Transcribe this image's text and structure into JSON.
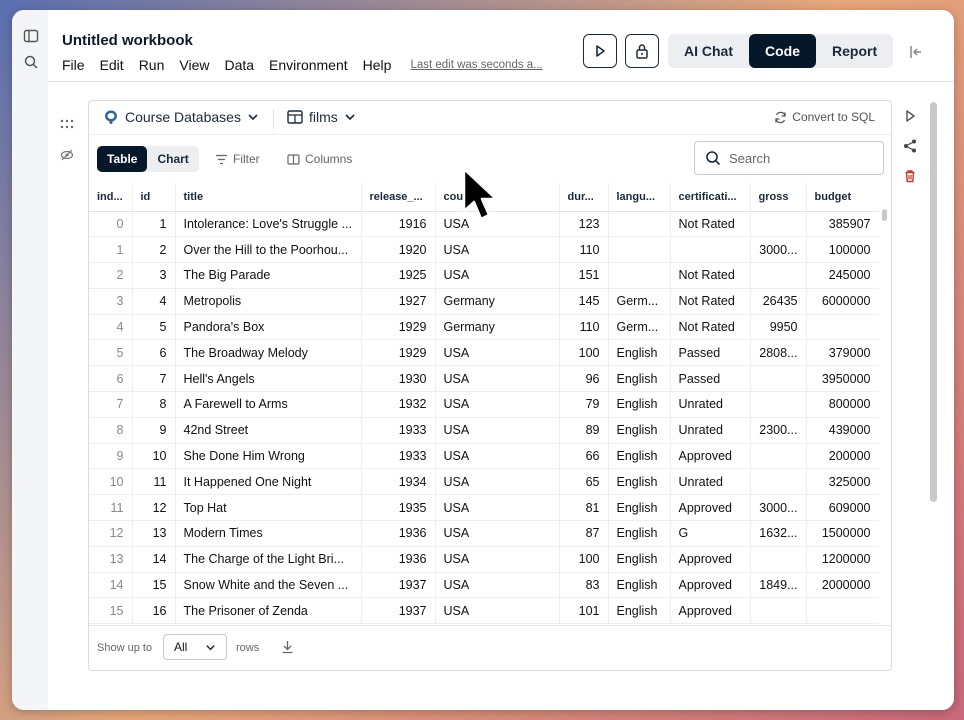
{
  "app": {
    "title": "Untitled workbook",
    "menu": [
      "File",
      "Edit",
      "Run",
      "View",
      "Data",
      "Environment",
      "Help"
    ],
    "last_edit": "Last edit was seconds a...",
    "modes": [
      "AI Chat",
      "Code",
      "Report"
    ],
    "active_mode": "Code"
  },
  "cell": {
    "database": "Course Databases",
    "table": "films",
    "convert_label": "Convert to SQL",
    "views": [
      "Table",
      "Chart"
    ],
    "active_view": "Table",
    "filter_label": "Filter",
    "columns_label": "Columns",
    "search_placeholder": "Search"
  },
  "grid": {
    "columns": [
      "ind...",
      "id",
      "title",
      "release_...",
      "cou",
      "dur...",
      "langu...",
      "certificati...",
      "gross",
      "budget"
    ],
    "rows": [
      [
        "0",
        "1",
        "Intolerance: Love's Struggle ...",
        "1916",
        "USA",
        "123",
        "",
        "Not Rated",
        "",
        "385907"
      ],
      [
        "1",
        "2",
        "Over the Hill to the Poorhou...",
        "1920",
        "USA",
        "110",
        "",
        "",
        "3000...",
        "100000"
      ],
      [
        "2",
        "3",
        "The Big Parade",
        "1925",
        "USA",
        "151",
        "",
        "Not Rated",
        "",
        "245000"
      ],
      [
        "3",
        "4",
        "Metropolis",
        "1927",
        "Germany",
        "145",
        "Germ...",
        "Not Rated",
        "26435",
        "6000000"
      ],
      [
        "4",
        "5",
        "Pandora's Box",
        "1929",
        "Germany",
        "110",
        "Germ...",
        "Not Rated",
        "9950",
        ""
      ],
      [
        "5",
        "6",
        "The Broadway Melody",
        "1929",
        "USA",
        "100",
        "English",
        "Passed",
        "2808...",
        "379000"
      ],
      [
        "6",
        "7",
        "Hell's Angels",
        "1930",
        "USA",
        "96",
        "English",
        "Passed",
        "",
        "3950000"
      ],
      [
        "7",
        "8",
        "A Farewell to Arms",
        "1932",
        "USA",
        "79",
        "English",
        "Unrated",
        "",
        "800000"
      ],
      [
        "8",
        "9",
        "42nd Street",
        "1933",
        "USA",
        "89",
        "English",
        "Unrated",
        "2300...",
        "439000"
      ],
      [
        "9",
        "10",
        "She Done Him Wrong",
        "1933",
        "USA",
        "66",
        "English",
        "Approved",
        "",
        "200000"
      ],
      [
        "10",
        "11",
        "It Happened One Night",
        "1934",
        "USA",
        "65",
        "English",
        "Unrated",
        "",
        "325000"
      ],
      [
        "11",
        "12",
        "Top Hat",
        "1935",
        "USA",
        "81",
        "English",
        "Approved",
        "3000...",
        "609000"
      ],
      [
        "12",
        "13",
        "Modern Times",
        "1936",
        "USA",
        "87",
        "English",
        "G",
        "1632...",
        "1500000"
      ],
      [
        "13",
        "14",
        "The Charge of the Light Bri...",
        "1936",
        "USA",
        "100",
        "English",
        "Approved",
        "",
        "1200000"
      ],
      [
        "14",
        "15",
        "Snow White and the Seven ...",
        "1937",
        "USA",
        "83",
        "English",
        "Approved",
        "1849...",
        "2000000"
      ],
      [
        "15",
        "16",
        "The Prisoner of Zenda",
        "1937",
        "USA",
        "101",
        "English",
        "Approved",
        "",
        ""
      ]
    ]
  },
  "footer": {
    "show_label": "Show up to",
    "rows_value": "All",
    "rows_label": "rows"
  }
}
